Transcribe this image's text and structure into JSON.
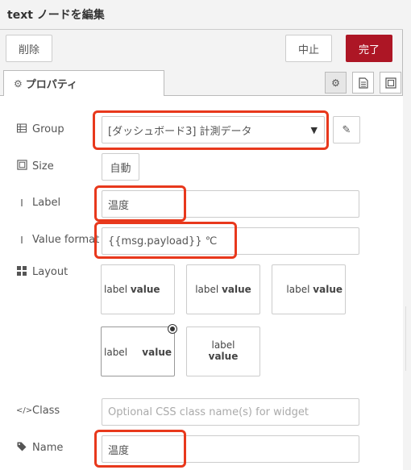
{
  "title": "text ノードを編集",
  "toolbar": {
    "delete_label": "削除",
    "cancel_label": "中止",
    "done_label": "完了"
  },
  "tabs": {
    "properties_label": "プロパティ"
  },
  "icons": {
    "tab_properties": "gear-icon",
    "tab_settings": "gear-icon",
    "tab_description": "document-icon",
    "tab_appearance": "frame-icon",
    "group": "table-icon",
    "size": "frame-icon",
    "label": "text-cursor-icon",
    "value_format": "text-cursor-icon",
    "layout": "grid-icon",
    "class": "code-icon",
    "name": "tag-icon",
    "edit": "pencil-icon"
  },
  "colors": {
    "primary": "#ad1625",
    "highlight": "#e8381c"
  },
  "form": {
    "group": {
      "label": "Group",
      "value": "[ダッシュボード3] 計測データ"
    },
    "size": {
      "label": "Size",
      "button": "自動"
    },
    "label": {
      "label": "Label",
      "value": "温度"
    },
    "value_format": {
      "label": "Value format",
      "value": "{{msg.payload}} ℃"
    },
    "layout": {
      "label": "Layout",
      "options": [
        {
          "label": "label",
          "value": "value"
        },
        {
          "label": "label",
          "value": "value"
        },
        {
          "label": "label",
          "value": "value"
        },
        {
          "label": "label",
          "value": "value",
          "selected": true
        },
        {
          "label": "label",
          "value": "value"
        }
      ]
    },
    "class": {
      "label": "Class",
      "placeholder": "Optional CSS class name(s) for widget"
    },
    "name": {
      "label": "Name",
      "value": "温度"
    }
  }
}
